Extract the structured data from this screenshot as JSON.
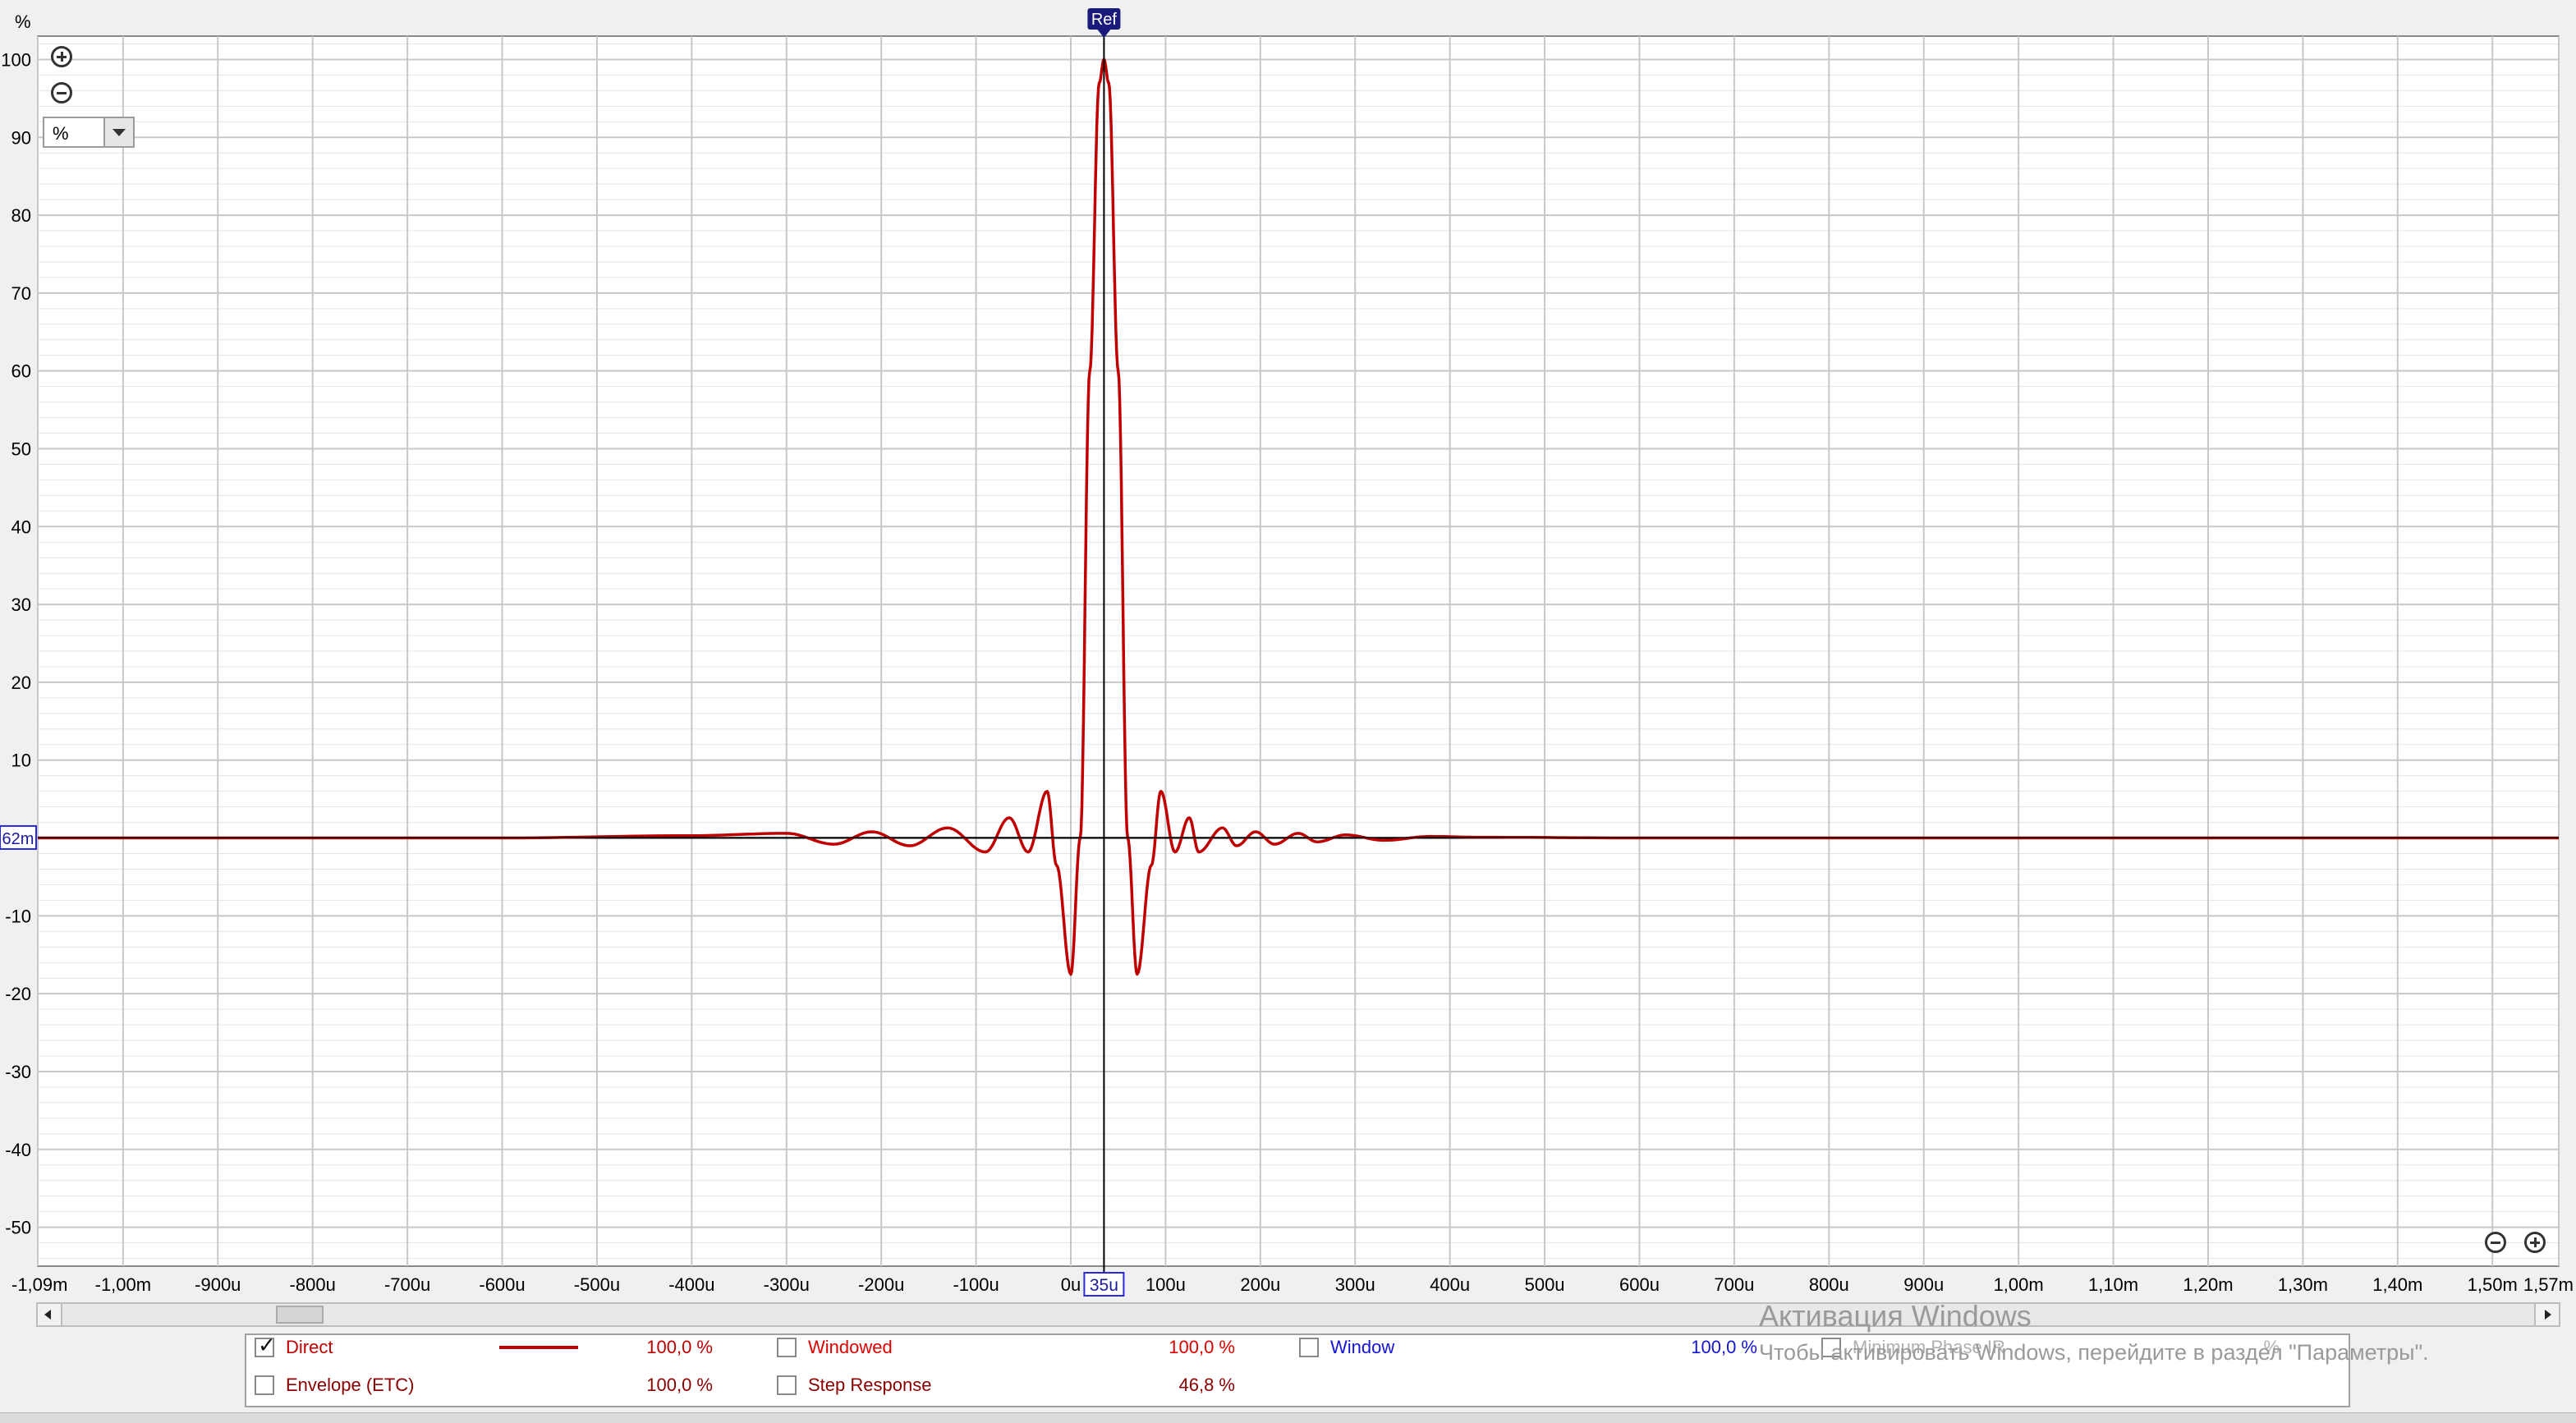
{
  "colors": {
    "curve": "#c00000",
    "grid_major": "#c8c8c8",
    "grid_minor": "#e4e4e4",
    "plot_bg": "#ffffff",
    "cursor_label": "#1a1a7a",
    "window_blue": "#1414d8",
    "label_red": "#c00000",
    "label_darkred": "#8b0000"
  },
  "chart": {
    "y_unit_label": "%",
    "ref_marker_label": "Ref",
    "cursor_y_readout": "62m",
    "cursor_x_readout": "35u",
    "unit_select_value": "%",
    "zoom_in_icon": "zoom-in-icon",
    "zoom_out_icon": "zoom-out-icon"
  },
  "chart_data": {
    "type": "line",
    "title": "",
    "xlabel": "",
    "ylabel": "%",
    "x_unit": "seconds",
    "xlim": [
      -0.00109,
      0.00157
    ],
    "ylim": [
      -55,
      103
    ],
    "grid": true,
    "x_tick_values": [
      -0.00109,
      -0.001,
      -0.0009,
      -0.0008,
      -0.0007,
      -0.0006,
      -0.0005,
      -0.0004,
      -0.0003,
      -0.0002,
      -0.0001,
      0,
      0.0001,
      0.0002,
      0.0003,
      0.0004,
      0.0005,
      0.0006,
      0.0007,
      0.0008,
      0.0009,
      0.001,
      0.0011,
      0.0012,
      0.0013,
      0.0014,
      0.0015,
      0.00157
    ],
    "x_tick_labels": [
      "-1,09m",
      "-1,00m",
      "-900u",
      "-800u",
      "-700u",
      "-600u",
      "-500u",
      "-400u",
      "-300u",
      "-200u",
      "-100u",
      "0u",
      "100u",
      "200u",
      "300u",
      "400u",
      "500u",
      "600u",
      "700u",
      "800u",
      "900u",
      "1,00m",
      "1,10m",
      "1,20m",
      "1,30m",
      "1,40m",
      "1,50m",
      "1,57m"
    ],
    "y_tick_values": [
      100,
      90,
      80,
      70,
      60,
      50,
      40,
      30,
      20,
      10,
      0,
      -10,
      -20,
      -30,
      -40,
      -50
    ],
    "y_tick_labels": [
      "100",
      "90",
      "80",
      "70",
      "60",
      "50",
      "40",
      "30",
      "20",
      "10",
      "",
      "-10",
      "-20",
      "-30",
      "-40",
      "-50"
    ],
    "series": [
      {
        "name": "Direct",
        "x": [
          -0.00109,
          -0.0006,
          -0.0004,
          -0.0003,
          -0.00025,
          -0.00021,
          -0.00017,
          -0.00013,
          -9e-05,
          -6.5e-05,
          -4.5e-05,
          -2.5e-05,
          -1.5e-05,
          0.0,
          1e-05,
          2e-05,
          3e-05,
          3.5e-05,
          4e-05,
          5e-05,
          6e-05,
          7e-05,
          8.5e-05,
          9.5e-05,
          0.00011,
          0.000125,
          0.000135,
          0.00016,
          0.000175,
          0.000195,
          0.000215,
          0.00024,
          0.00026,
          0.00029,
          0.00033,
          0.00038,
          0.00043,
          0.0006,
          0.00157
        ],
        "y": [
          0.0,
          0.0,
          0.3,
          0.6,
          -0.8,
          0.8,
          -1.0,
          1.3,
          -1.8,
          2.6,
          -1.8,
          6.0,
          -3.5,
          -17.5,
          0.0,
          60.0,
          97.0,
          100.0,
          97.0,
          60.0,
          0.0,
          -17.5,
          -3.5,
          6.0,
          -1.8,
          2.6,
          -1.8,
          1.3,
          -1.0,
          0.8,
          -0.8,
          0.6,
          -0.5,
          0.4,
          -0.3,
          0.2,
          0.1,
          0.0,
          0.0
        ]
      }
    ],
    "cursor_x": 3.5e-05,
    "cursor_y": 0.062,
    "ref_x": 3.5e-05
  },
  "legend": {
    "rows": [
      {
        "items": [
          {
            "label": "Direct",
            "checked": true,
            "value": "100,0 %",
            "color": "#c00000",
            "show_line": true
          },
          {
            "label": "Windowed",
            "checked": false,
            "value": "100,0 %",
            "color": "#e00000"
          },
          {
            "label": "Window",
            "checked": false,
            "value": "100,0 %",
            "color": "#1414d8"
          },
          {
            "label": "Minimum Phase IR",
            "checked": false,
            "value": "%",
            "color": "#b0b0b0"
          }
        ]
      },
      {
        "items": [
          {
            "label": "Envelope (ETC)",
            "checked": false,
            "value": "100,0 %",
            "color": "#8b0000"
          },
          {
            "label": "Step Response",
            "checked": false,
            "value": "46,8 %",
            "color": "#8b0000"
          }
        ]
      }
    ]
  },
  "watermark": {
    "title": "Активация Windows",
    "subtitle": "Чтобы активировать Windows, перейдите в раздел \"Параметры\"."
  }
}
